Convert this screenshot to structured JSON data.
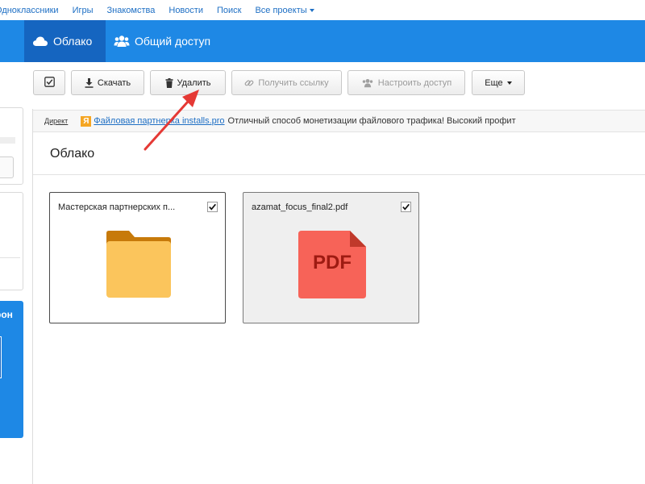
{
  "topnav": {
    "items": [
      "Одноклассники",
      "Игры",
      "Знакомства",
      "Новости",
      "Поиск",
      "Все проекты"
    ]
  },
  "header": {
    "tabs": [
      {
        "label": "Облако",
        "active": true
      },
      {
        "label": "Общий доступ",
        "active": false
      }
    ]
  },
  "toolbar": {
    "download_label": "Скачать",
    "delete_label": "Удалить",
    "get_link_label": "Получить ссылку",
    "share_settings_label": "Настроить доступ",
    "more_label": "Еще"
  },
  "ad": {
    "direct_label": "Директ",
    "link_text": "Файловая партнерка installs.pro",
    "body_text": "Отличный способ монетизации файлового трафика! Высокий профит"
  },
  "sidebar": {
    "blue_panel_text": "рон"
  },
  "main": {
    "title": "Облако",
    "files": [
      {
        "name": "Мастерская партнерских п...",
        "type": "folder",
        "checked": true,
        "selected": false
      },
      {
        "name": "azamat_focus_final2.pdf",
        "type": "pdf",
        "checked": true,
        "selected": true,
        "badge": "PDF"
      }
    ]
  },
  "colors": {
    "header_blue": "#1e88e5",
    "active_tab": "#1565c0",
    "folder": "#fbc55c",
    "folder_tab": "#c77a0a",
    "pdf": "#f76358",
    "pdf_fold": "#c0392b",
    "annotation": "#e53935"
  }
}
